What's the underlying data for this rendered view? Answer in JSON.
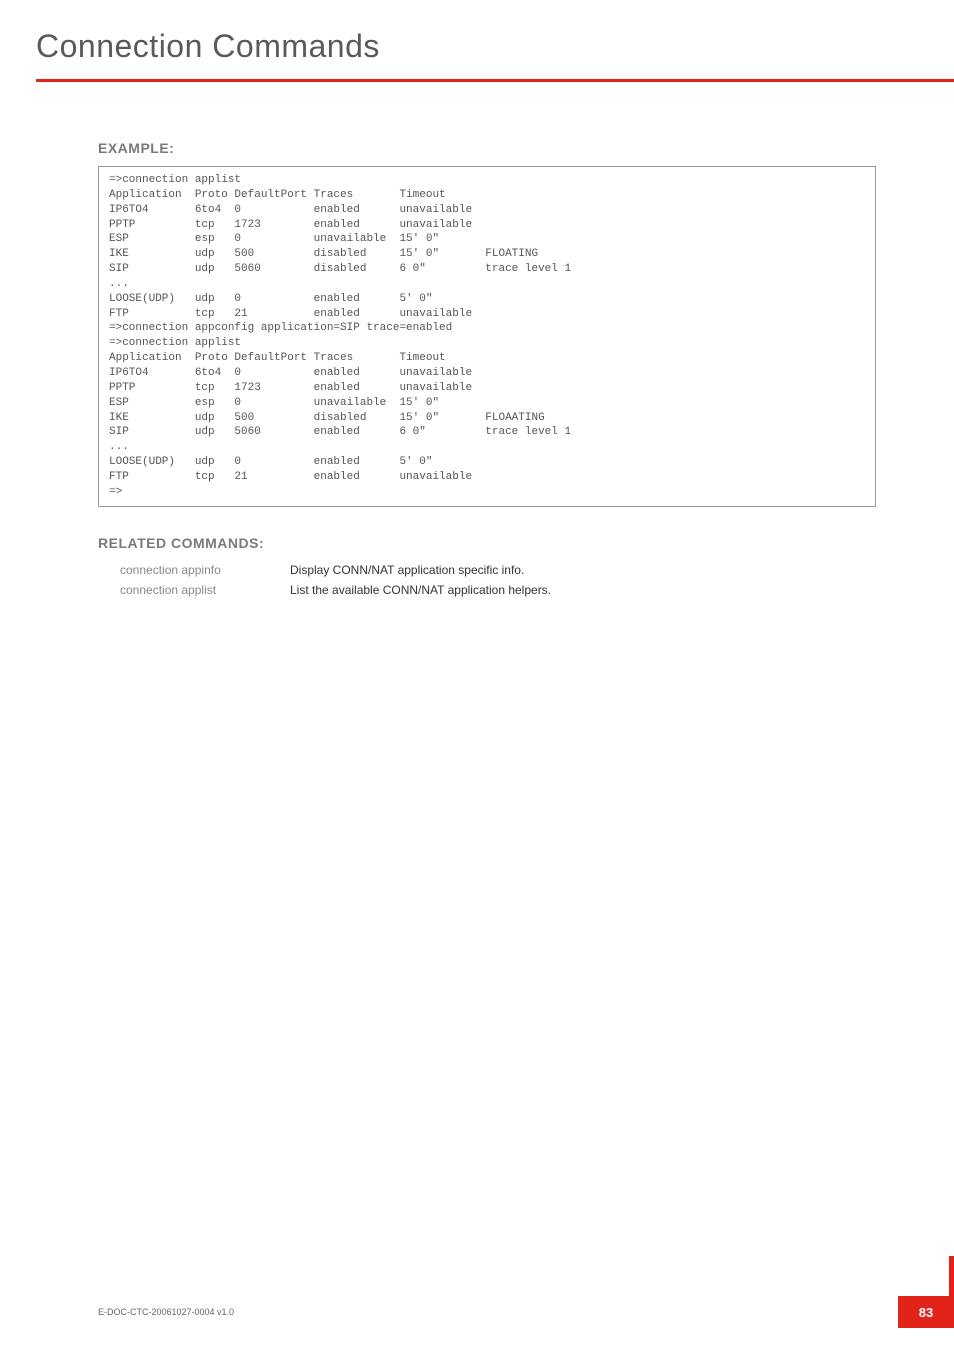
{
  "header": {
    "title": "Connection Commands"
  },
  "example": {
    "heading": "EXAMPLE:",
    "code": "=>connection applist\nApplication  Proto DefaultPort Traces       Timeout\nIP6TO4       6to4  0           enabled      unavailable\nPPTP         tcp   1723        enabled      unavailable\nESP          esp   0           unavailable  15' 0\"\nIKE          udp   500         disabled     15' 0\"       FLOATING\nSIP          udp   5060        disabled     6 0\"         trace level 1\n...\nLOOSE(UDP)   udp   0           enabled      5' 0\"\nFTP          tcp   21          enabled      unavailable\n=>connection appconfig application=SIP trace=enabled\n=>connection applist\nApplication  Proto DefaultPort Traces       Timeout\nIP6TO4       6to4  0           enabled      unavailable\nPPTP         tcp   1723        enabled      unavailable\nESP          esp   0           unavailable  15' 0\"\nIKE          udp   500         disabled     15' 0\"       FLOAATING\nSIP          udp   5060        enabled      6 0\"         trace level 1\n...\nLOOSE(UDP)   udp   0           enabled      5' 0\"\nFTP          tcp   21          enabled      unavailable\n=>"
  },
  "related": {
    "heading": "RELATED COMMANDS:",
    "rows": [
      {
        "cmd": "connection appinfo",
        "desc": "Display CONN/NAT application specific info."
      },
      {
        "cmd": "connection applist",
        "desc": "List the available CONN/NAT application helpers."
      }
    ]
  },
  "footer": {
    "doc_id": "E-DOC-CTC-20061027-0004 v1.0",
    "page": "83"
  }
}
